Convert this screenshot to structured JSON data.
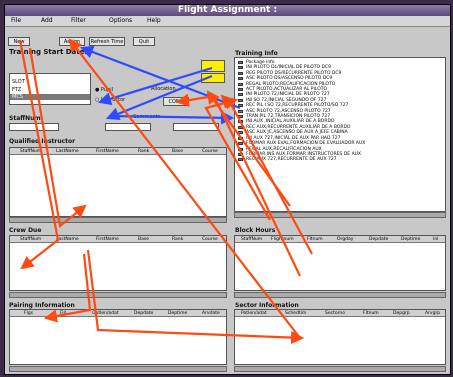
{
  "window": {
    "title": "Flight Assignment :"
  },
  "menu": [
    "File",
    "Add",
    "Filter",
    "Options",
    "Help"
  ],
  "toolbar": {
    "new": "New",
    "assign": "Assign",
    "refresh": "Refresh Time",
    "quit": "Quit"
  },
  "training": {
    "title": "Training Start Dates",
    "options": [
      "SLOT",
      "FTZ",
      "MCS"
    ],
    "radio_pupil": "Pupil",
    "radio_instructor": "Instructor",
    "allocation_label": "Allocation",
    "cond_label": "COND",
    "staff_label": "StaffNum",
    "comments_label": "Comments"
  },
  "training_info": {
    "title": "Training Info",
    "items": [
      "Package info",
      "INI PILOTO DL/INICIAL DE PILOTO DC9",
      "REG PILOTO DS/RECURRENTE PILOTO DC9",
      "ASC PILOTO DS/ASCENSO PILOTO DC9",
      "REGAL PILOTO,RECALIFICACION PILOTO",
      "ACT PILOTO,ACTUALIZAR AL PILOTO",
      "INI PILOTO 72,INICIAL DE PILOTO 727",
      "INI SO 72,INICIAL SEGUNDO OF 727",
      "REC PIL I SO 72,RECURRENTE PILOTO/SO 727",
      "ASC PILOTO 72,ASCENSO PILOTO 727",
      "TRAN PIL 72,TRANSICION PILOTO 727",
      "INI AUX ,INICIAL AUXILIAR DE A BORDO",
      "REC AUX,RECURRENTE AUXILIAR DE A BORDO",
      "ASC AUX JC,ASCENSO DE AUX A JEFE CABINA",
      "INI AUX 727,INICIAL DE AUX PAR HAD 727",
      "FORMAR AUX EVAL,FORMACION DE EVALUADOR AUX",
      "REGAL AUX,RECALIFICACION AUX",
      "FORMAR INS AUX,FORMAR INSTRUCTORES DE AUX",
      "REC AUX 727,RECURRENTE DE AUX 727"
    ]
  },
  "qualified": {
    "title": "Qualified Instructor",
    "cols": [
      "StaffNum",
      "LastName",
      "FirstName",
      "Rank",
      "Base",
      "Course"
    ]
  },
  "crew_due": {
    "title": "Crew Due",
    "cols": [
      "StaffNum",
      "LastName",
      "FirstName",
      "Base",
      "Rank",
      "Course"
    ]
  },
  "block_hours": {
    "title": "Block Hours",
    "cols": [
      "StaffNum",
      "Flightnum",
      "Fltnum",
      "Orgday",
      "Depdate",
      "Deptime",
      "Inl"
    ]
  },
  "pairing": {
    "title": "Pairing Information",
    "cols": [
      "Flgs",
      "Fill",
      "Outlen/adat",
      "Depdate",
      "Deptime",
      "Arvdate"
    ]
  },
  "sector": {
    "title": "Sector Information",
    "cols": [
      "Potlen/adat",
      "Schedtim",
      "Sectorno",
      "Fltnum",
      "Depgrp",
      "Arvgrp"
    ]
  }
}
